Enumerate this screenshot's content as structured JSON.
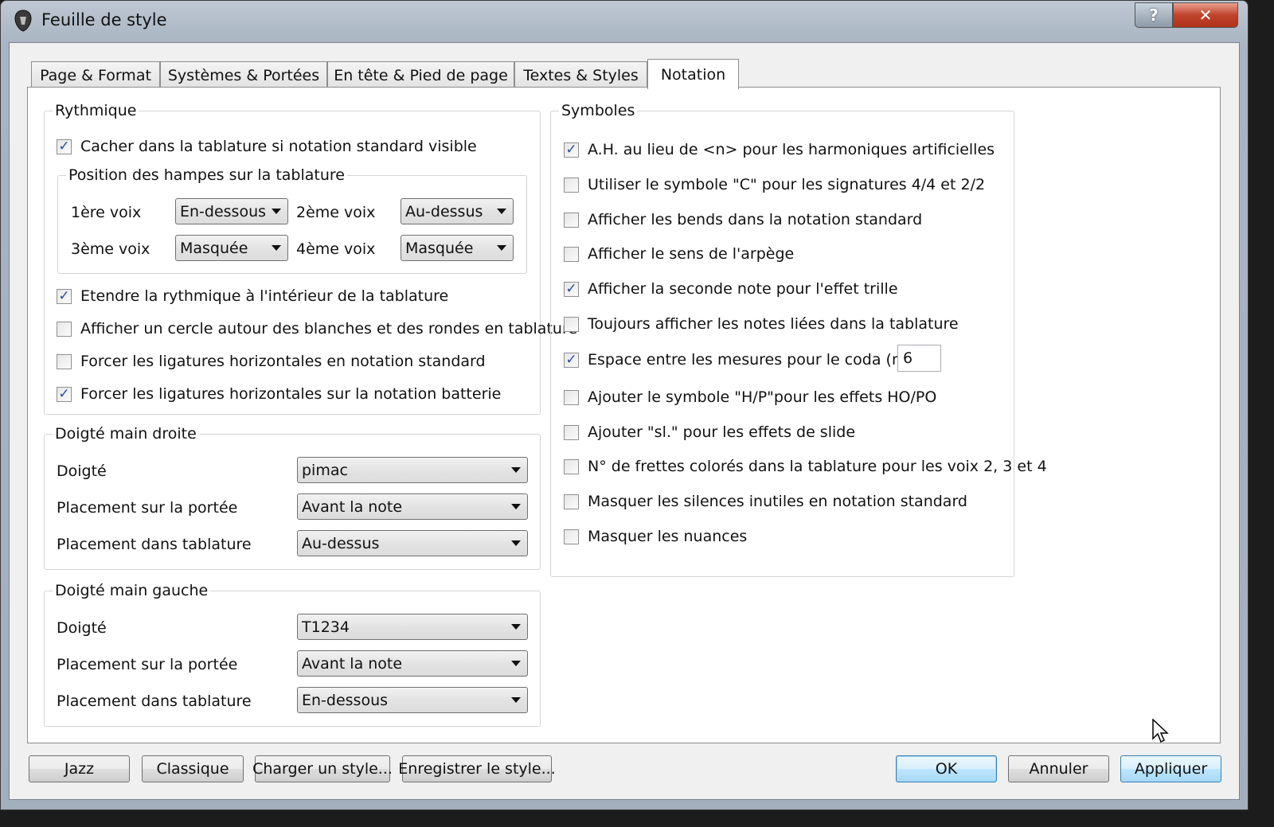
{
  "window": {
    "title": "Feuille de style",
    "help_label": "?",
    "close_label": "✕"
  },
  "tabs": [
    {
      "label": "Page & Format"
    },
    {
      "label": "Systèmes & Portées"
    },
    {
      "label": "En tête & Pied de page"
    },
    {
      "label": "Textes & Styles"
    },
    {
      "label": "Notation"
    }
  ],
  "active_tab": "Notation",
  "rythmique": {
    "title": "Rythmique",
    "hide_in_tab": {
      "label": "Cacher dans la tablature si notation standard visible",
      "checked": true
    },
    "stems": {
      "title": "Position des hampes sur la tablature",
      "voice1_label": "1ère voix",
      "voice1_value": "En-dessous",
      "voice2_label": "2ème voix",
      "voice2_value": "Au-dessus",
      "voice3_label": "3ème voix",
      "voice3_value": "Masquée",
      "voice4_label": "4ème voix",
      "voice4_value": "Masquée"
    },
    "extend": {
      "label": "Etendre la rythmique à l'intérieur de la tablature",
      "checked": true
    },
    "circle": {
      "label": "Afficher un cercle autour des blanches et des rondes en tablature",
      "checked": false
    },
    "force_std": {
      "label": "Forcer les ligatures horizontales en notation standard",
      "checked": false
    },
    "force_drum": {
      "label": "Forcer les ligatures horizontales sur la notation batterie",
      "checked": true
    }
  },
  "right_hand": {
    "title": "Doigté main droite",
    "fingering_label": "Doigté",
    "fingering_value": "pimac",
    "staff_label": "Placement sur la portée",
    "staff_value": "Avant la note",
    "tab_label": "Placement dans tablature",
    "tab_value": "Au-dessus"
  },
  "left_hand": {
    "title": "Doigté main gauche",
    "fingering_label": "Doigté",
    "fingering_value": "T1234",
    "staff_label": "Placement sur la portée",
    "staff_value": "Avant la note",
    "tab_label": "Placement dans tablature",
    "tab_value": "En-dessous"
  },
  "symboles": {
    "title": "Symboles",
    "items": [
      {
        "label": "A.H. au lieu de <n> pour les harmoniques artificielles",
        "checked": true
      },
      {
        "label": "Utiliser le symbole \"C\" pour les signatures 4/4 et 2/2",
        "checked": false
      },
      {
        "label": "Afficher les bends dans la notation standard",
        "checked": false
      },
      {
        "label": "Afficher le sens de l'arpège",
        "checked": false
      },
      {
        "label": "Afficher la seconde note pour l'effet trille",
        "checked": true
      },
      {
        "label": "Toujours afficher les notes liées dans la tablature",
        "checked": false
      },
      {
        "label": "Espace entre les mesures pour le coda (mm)",
        "checked": true
      },
      {
        "label": "Ajouter le symbole \"H/P\"pour les effets HO/PO",
        "checked": false
      },
      {
        "label": "Ajouter \"sl.\" pour les effets de slide",
        "checked": false
      },
      {
        "label": "N° de frettes colorés dans la tablature pour les voix 2, 3 et 4",
        "checked": false
      },
      {
        "label": "Masquer les silences inutiles en notation standard",
        "checked": false
      },
      {
        "label": "Masquer les nuances",
        "checked": false
      }
    ],
    "coda_value": "6"
  },
  "buttons": {
    "jazz": "Jazz",
    "classique": "Classique",
    "load": "Charger un style...",
    "save": "Enregistrer le style...",
    "ok": "OK",
    "cancel": "Annuler",
    "apply": "Appliquer"
  }
}
